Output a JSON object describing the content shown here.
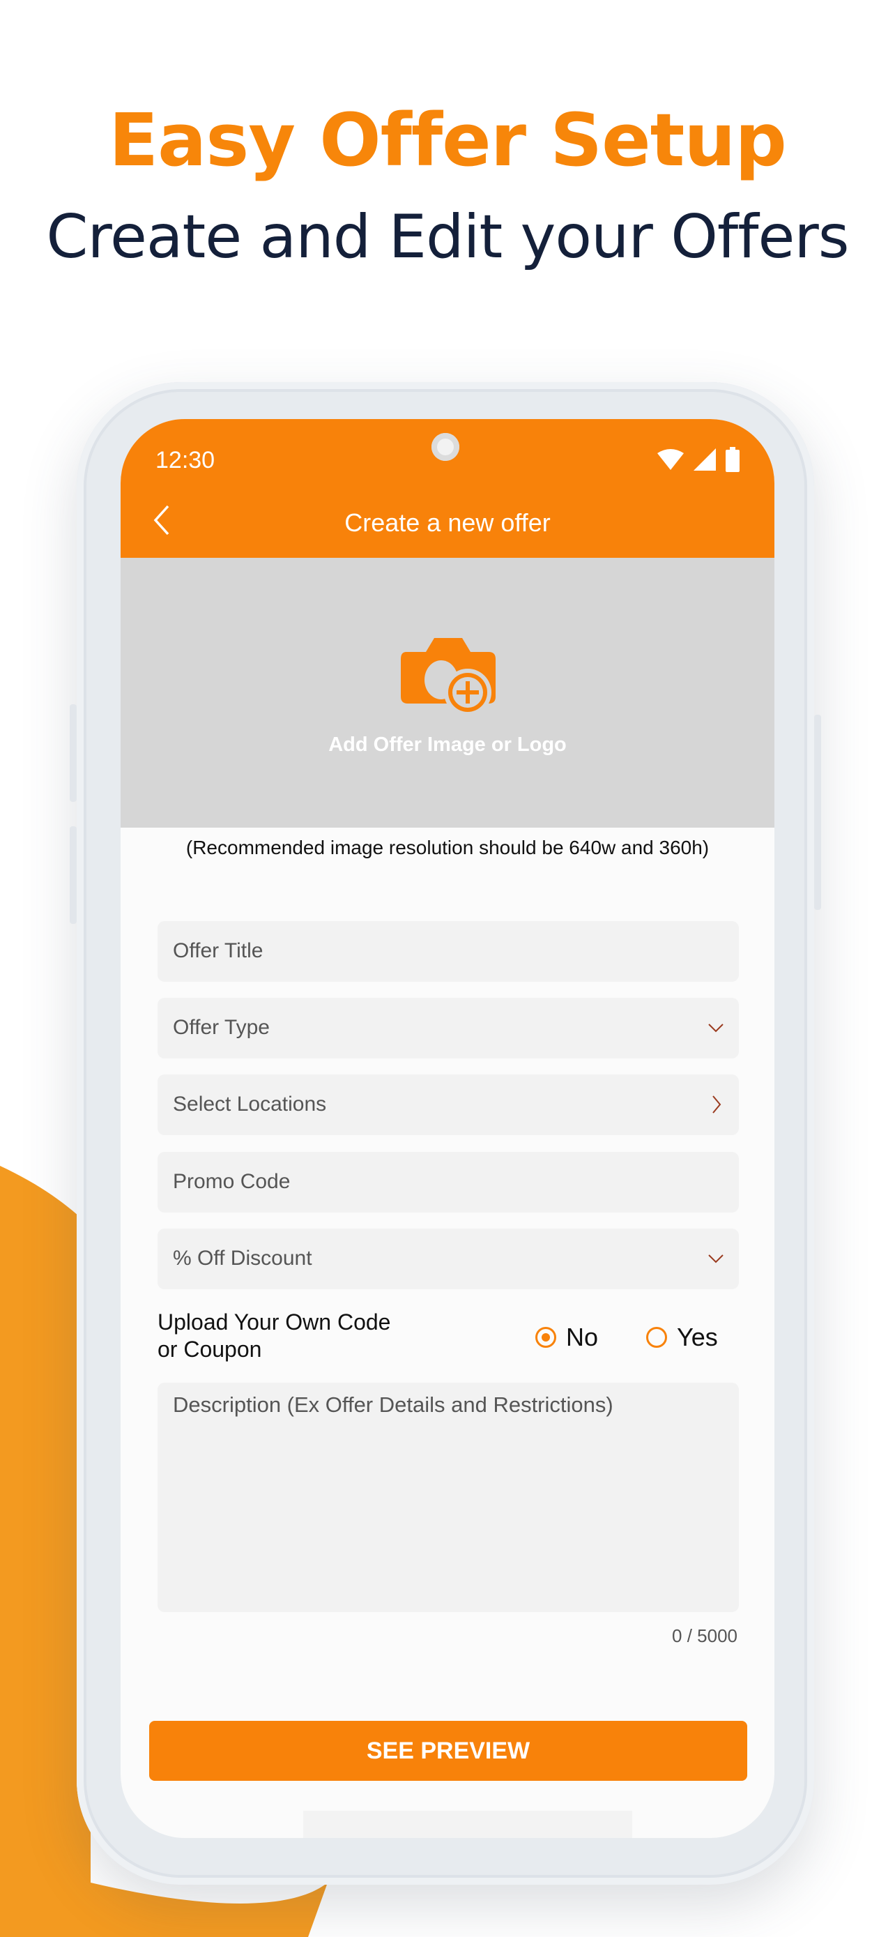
{
  "promo": {
    "headline": "Easy Offer Setup",
    "subheadline": "Create and Edit your Offers",
    "accent_color": "#F7860A",
    "text_color": "#14203a"
  },
  "status_bar": {
    "time": "12:30",
    "icons": [
      "wifi-icon",
      "signal-icon",
      "battery-icon"
    ]
  },
  "app_bar": {
    "title": "Create a new offer",
    "back_icon": "chevron-left-icon",
    "color": "#F8820A"
  },
  "image_upload": {
    "icon": "camera-add-icon",
    "label": "Add Offer Image or Logo",
    "hint": "(Recommended image resolution should be 640w and 360h)"
  },
  "form": {
    "fields": [
      {
        "placeholder": "Offer Title",
        "type": "text"
      },
      {
        "placeholder": "Offer Type",
        "type": "dropdown",
        "icon": "chevron-down-icon"
      },
      {
        "placeholder": "Select Locations",
        "type": "navigation",
        "icon": "chevron-right-icon"
      },
      {
        "placeholder": "Promo Code",
        "type": "text"
      },
      {
        "placeholder": "% Off Discount",
        "type": "dropdown",
        "icon": "chevron-down-icon"
      }
    ],
    "upload_code": {
      "label_line1": "Upload Your Own Code",
      "label_line2": "or Coupon",
      "options": [
        {
          "label": "No",
          "selected": true
        },
        {
          "label": "Yes",
          "selected": false
        }
      ]
    },
    "description": {
      "placeholder": "Description (Ex Offer Details and Restrictions)",
      "counter": "0 / 5000"
    },
    "submit_label": "SEE PREVIEW"
  }
}
